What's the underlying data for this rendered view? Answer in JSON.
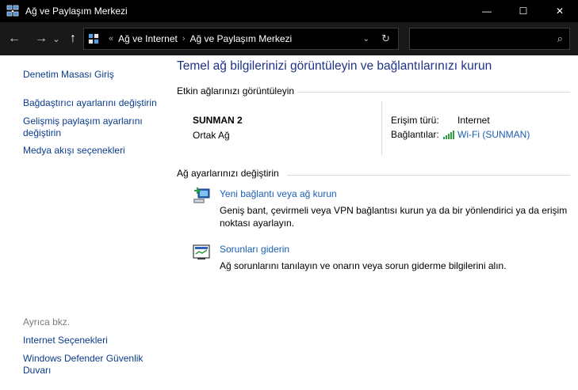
{
  "window": {
    "title": "Ağ ve Paylaşım Merkezi",
    "minimize_glyph": "—",
    "maximize_glyph": "☐",
    "close_glyph": "✕"
  },
  "navigation": {
    "back_glyph": "←",
    "forward_glyph": "→",
    "recent_glyph": "⌄",
    "up_glyph": "↑",
    "overflow_glyph": "«",
    "breadcrumbs": [
      "Ağ ve Internet",
      "Ağ ve Paylaşım Merkezi"
    ],
    "crumb_separator": "›",
    "dropdown_glyph": "⌄",
    "refresh_glyph": "↻",
    "search": {
      "value": "",
      "placeholder": ""
    }
  },
  "sidebar": {
    "top_links": [
      "Denetim Masası Giriş",
      "Bağdaştırıcı ayarlarını değiştirin",
      "Gelişmiş paylaşım ayarlarını değiştirin",
      "Medya akışı seçenekleri"
    ],
    "see_also_heading": "Ayrıca bkz.",
    "see_also_links": [
      "Internet Seçenekleri",
      "Windows Defender Güvenlik Duvarı"
    ]
  },
  "main": {
    "title": "Temel ağ bilgilerinizi görüntüleyin ve bağlantılarınızı kurun",
    "active_networks": {
      "heading": "Etkin ağlarınızı görüntüleyin",
      "network_name": "SUNMAN 2",
      "network_category": "Ortak Ağ",
      "access_type_label": "Erişim türü:",
      "access_type_value": "Internet",
      "connections_label": "Bağlantılar:",
      "connections_value": "Wi-Fi (SUNMAN)"
    },
    "change_settings": {
      "heading": "Ağ ayarlarınızı değiştirin",
      "tasks": [
        {
          "icon": "network-setup-icon",
          "link": "Yeni bağlantı veya ağ kurun",
          "description": "Geniş bant, çevirmeli veya VPN bağlantısı kurun ya da bir yönlendirici ya da erişim noktası ayarlayın."
        },
        {
          "icon": "troubleshoot-icon",
          "link": "Sorunları giderin",
          "description": "Ağ sorunlarını tanılayın ve onarın veya sorun giderme bilgilerini alın."
        }
      ]
    }
  },
  "colors": {
    "titlebar": "#000000",
    "navbar": "#191919",
    "link": "#1a5fb4",
    "page_title": "#1e3287",
    "sidebar_link": "#0b3b8c",
    "muted": "#7a7a7a"
  }
}
